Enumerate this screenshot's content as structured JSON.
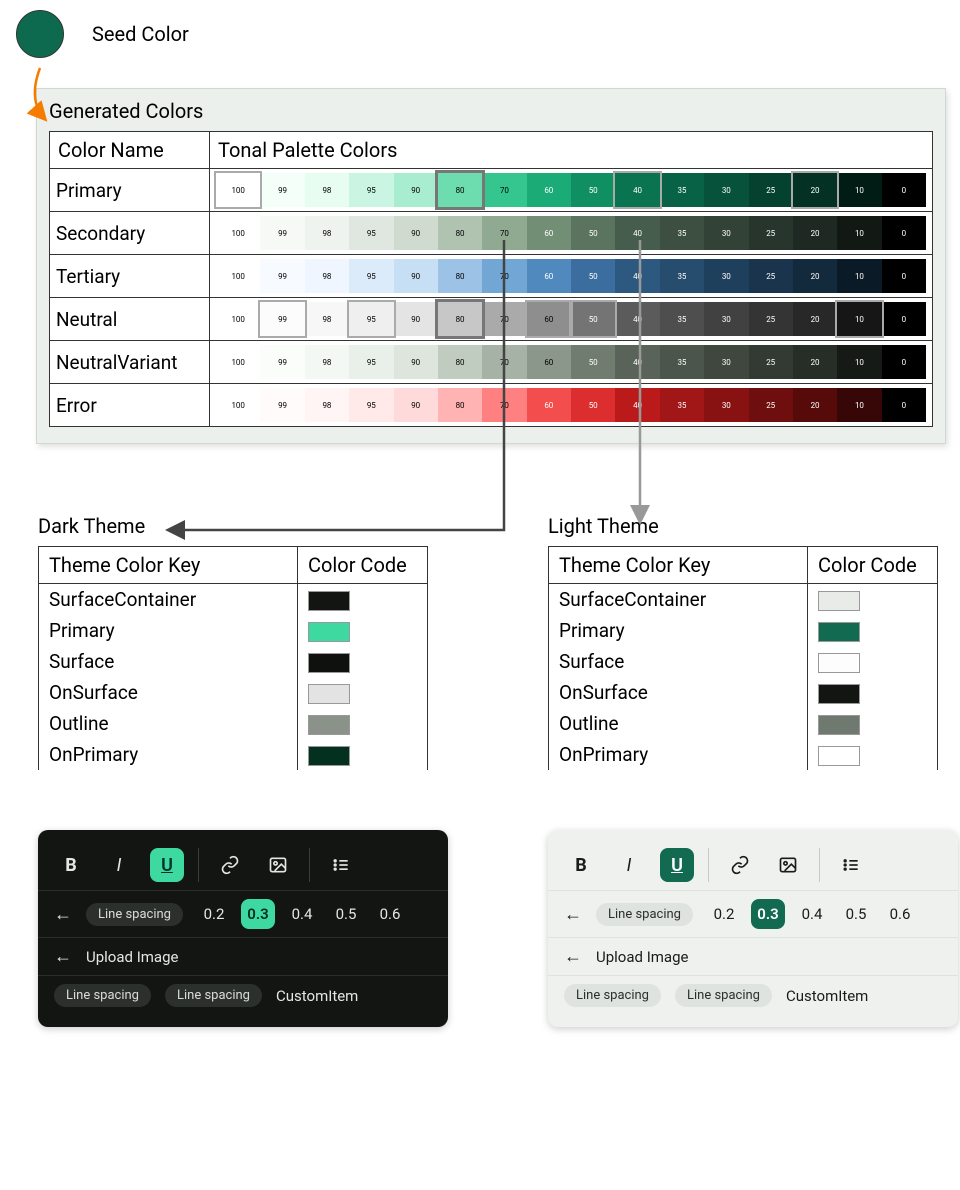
{
  "seed": {
    "label": "Seed Color",
    "color": "#0E6A4F"
  },
  "generated": {
    "title": "Generated Colors",
    "headers": {
      "name": "Color Name",
      "palette": "Tonal Palette Colors"
    },
    "tones": [
      100,
      99,
      98,
      95,
      90,
      80,
      70,
      60,
      50,
      40,
      35,
      30,
      25,
      20,
      10,
      0
    ],
    "rows": [
      {
        "name": "Primary",
        "colors": [
          "#ffffff",
          "#f4fff9",
          "#e8fdf2",
          "#c9f5e2",
          "#a9edd1",
          "#6ddcaf",
          "#34c68e",
          "#1aab77",
          "#0f8f62",
          "#0a7350",
          "#086245",
          "#06523a",
          "#05412f",
          "#033225",
          "#011c14",
          "#000000"
        ],
        "highlights": {
          "100": "light",
          "80": "strong",
          "40": "light",
          "20": "light"
        }
      },
      {
        "name": "Secondary",
        "colors": [
          "#ffffff",
          "#f7f9f7",
          "#eff3ef",
          "#e0e7e0",
          "#d0dbd0",
          "#b0c3b1",
          "#90aa92",
          "#728f76",
          "#5a745f",
          "#465c4c",
          "#3c4f41",
          "#324237",
          "#28352d",
          "#1f2923",
          "#121814",
          "#000000"
        ]
      },
      {
        "name": "Tertiary",
        "colors": [
          "#ffffff",
          "#f7fbff",
          "#eff6ff",
          "#dcebfa",
          "#c7dff4",
          "#9cc3e6",
          "#72a6d5",
          "#4f89be",
          "#3b6e9e",
          "#2d587f",
          "#264c6e",
          "#1f405d",
          "#19344c",
          "#13293c",
          "#0a1a27",
          "#000000"
        ]
      },
      {
        "name": "Neutral",
        "colors": [
          "#ffffff",
          "#fcfcfc",
          "#f7f7f7",
          "#efefef",
          "#e4e4e4",
          "#c7c7c7",
          "#aaaaaa",
          "#8e8e8e",
          "#747474",
          "#5b5b5b",
          "#4e4e4e",
          "#414141",
          "#343434",
          "#282828",
          "#161616",
          "#000000"
        ],
        "highlights": {
          "99": "light",
          "95": "light",
          "80": "strong",
          "60": "light",
          "50": "light",
          "10": "light"
        }
      },
      {
        "name": "NeutralVariant",
        "colors": [
          "#ffffff",
          "#fbfdfb",
          "#f4f8f4",
          "#e9efe9",
          "#dde5dd",
          "#c1ccc1",
          "#a5b2a5",
          "#8a978a",
          "#707c70",
          "#596359",
          "#4c554c",
          "#3f473f",
          "#333a33",
          "#272d27",
          "#161a16",
          "#000000"
        ]
      },
      {
        "name": "Error",
        "colors": [
          "#ffffff",
          "#fffbfb",
          "#fff5f5",
          "#ffe9e9",
          "#ffdada",
          "#ffb3b3",
          "#ff8080",
          "#f44d4d",
          "#dc2e2e",
          "#ba1a1a",
          "#a11616",
          "#881212",
          "#6f0e0e",
          "#570a0a",
          "#370606",
          "#000000"
        ]
      }
    ]
  },
  "themes": {
    "headers": {
      "key": "Theme Color Key",
      "code": "Color Code"
    },
    "dark": {
      "title": "Dark Theme",
      "rows": [
        {
          "key": "SurfaceContainer",
          "code": "#121512"
        },
        {
          "key": "Primary",
          "code": "#3dd9a1"
        },
        {
          "key": "Surface",
          "code": "#0f110f"
        },
        {
          "key": "OnSurface",
          "code": "#e3e3e3"
        },
        {
          "key": "Outline",
          "code": "#8a928a"
        },
        {
          "key": "OnPrimary",
          "code": "#03301f"
        }
      ]
    },
    "light": {
      "title": "Light Theme",
      "rows": [
        {
          "key": "SurfaceContainer",
          "code": "#e8ebe8"
        },
        {
          "key": "Primary",
          "code": "#126b51"
        },
        {
          "key": "Surface",
          "code": "#fcfdfc"
        },
        {
          "key": "OnSurface",
          "code": "#121512"
        },
        {
          "key": "Outline",
          "code": "#707970"
        },
        {
          "key": "OnPrimary",
          "code": "#ffffff"
        }
      ]
    }
  },
  "toolbar": {
    "spacing_label": "Line spacing",
    "spacing_values": [
      "0.2",
      "0.3",
      "0.4",
      "0.5",
      "0.6"
    ],
    "spacing_selected": "0.3",
    "upload_label": "Upload Image",
    "chip1": "Line spacing",
    "chip2": "Line spacing",
    "custom_item": "CustomItem"
  }
}
